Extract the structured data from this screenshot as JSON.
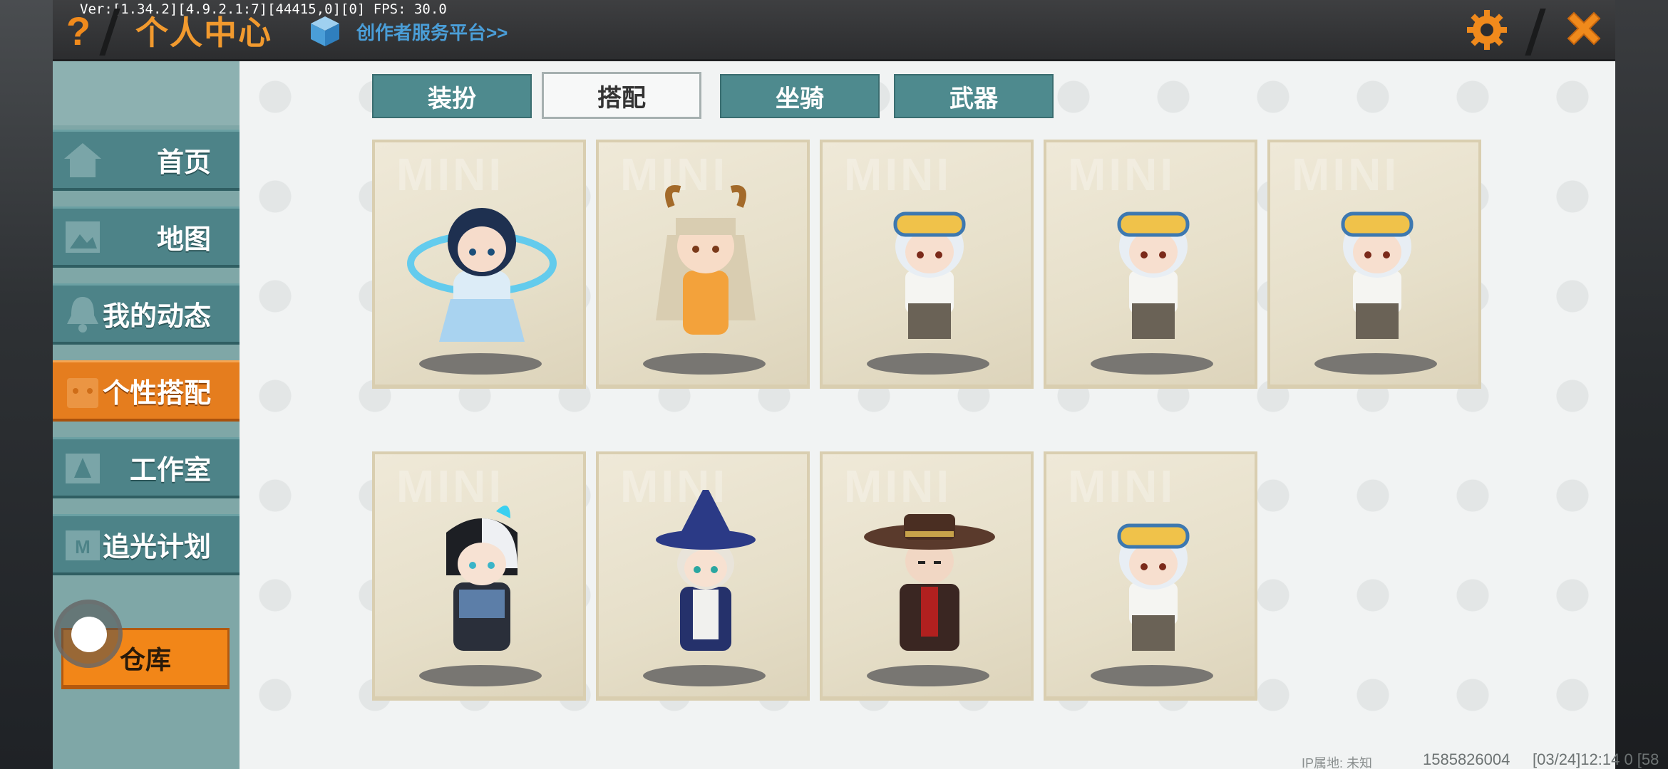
{
  "debug": {
    "version_text": "Ver:[1.34.2][4.9.2.1:7][44415,0][0] FPS: 30.0"
  },
  "header": {
    "help_symbol": "?",
    "title": "个人中心",
    "creator_link": "创作者服务平台>>",
    "settings_icon": "gear-icon",
    "close_icon": "close-icon",
    "accent_color": "#f08a1c"
  },
  "sidebar": {
    "items": [
      {
        "label": "首页",
        "icon": "home-icon"
      },
      {
        "label": "地图",
        "icon": "map-icon"
      },
      {
        "label": "我的动态",
        "icon": "bell-icon"
      },
      {
        "label": "个性搭配",
        "icon": "wardrobe-icon",
        "active": true
      },
      {
        "label": "工作室",
        "icon": "studio-icon"
      },
      {
        "label": "追光计划",
        "icon": "light-plan-icon"
      }
    ],
    "warehouse_label": "仓库"
  },
  "tabs": [
    {
      "label": "装扮"
    },
    {
      "label": "搭配",
      "active": true
    },
    {
      "label": "坐骑"
    },
    {
      "label": "武器"
    }
  ],
  "outfits": {
    "watermark": "MINI",
    "cards": [
      {
        "name": "blue-ribbon-girl"
      },
      {
        "name": "horned-orange-girl"
      },
      {
        "name": "goggles-boy"
      },
      {
        "name": "goggles-boy"
      },
      {
        "name": "goggles-boy"
      },
      {
        "name": "armored-white-hair"
      },
      {
        "name": "wizard-hat-boy"
      },
      {
        "name": "cowboy-hat-man"
      },
      {
        "name": "goggles-boy"
      }
    ]
  },
  "footer": {
    "ip_label": "IP属地: 未知",
    "user_id": "1585826004",
    "timestamp": "[03/24]12:14 0 [58"
  }
}
